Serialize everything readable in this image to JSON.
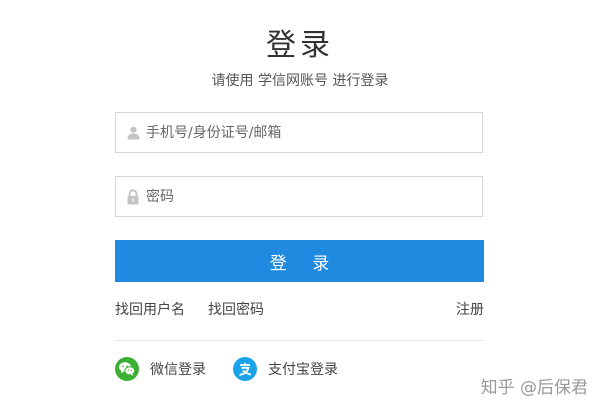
{
  "login": {
    "title": "登录",
    "subtitle": "请使用 学信网账号 进行登录",
    "username_placeholder": "手机号/身份证号/邮箱",
    "password_placeholder": "密码",
    "submit_label": "登 录"
  },
  "links": {
    "find_username": "找回用户名",
    "find_password": "找回密码",
    "register": "注册"
  },
  "social": {
    "wechat_label": "微信登录",
    "alipay_label": "支付宝登录"
  },
  "watermark": "知乎 @后保君",
  "colors": {
    "primary": "#1f8ae0",
    "wechat": "#3cb034",
    "alipay": "#1aa3e8"
  },
  "icons": {
    "username": "user-icon",
    "password": "lock-icon",
    "wechat": "wechat-icon",
    "alipay": "alipay-icon"
  }
}
